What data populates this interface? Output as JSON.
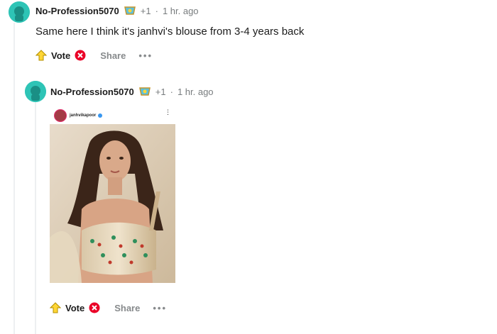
{
  "comments": [
    {
      "username": "No-Profession5070",
      "karma": "+1",
      "separator": "·",
      "time": "1 hr. ago",
      "text": "Same here I think it's janhvi's blouse from 3-4 years back",
      "actions": {
        "vote": "Vote",
        "share": "Share",
        "more": "•••"
      }
    },
    {
      "username": "No-Profession5070",
      "karma": "+1",
      "separator": "·",
      "time": "1 hr. ago",
      "image": {
        "handle": "janhvikapoor",
        "more": "⋮"
      },
      "actions": {
        "vote": "Vote",
        "share": "Share",
        "more": "•••"
      }
    }
  ],
  "colors": {
    "avatar": "#2ec4b6",
    "vote_icon": "#ffd635",
    "downvote_icon": "#ea0027",
    "muted": "#787c7e"
  },
  "icons": [
    "snoo-avatar-icon",
    "achievement-flair-icon",
    "upvote-icon",
    "downvote-icon",
    "more-icon",
    "verified-icon"
  ]
}
